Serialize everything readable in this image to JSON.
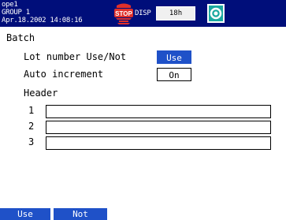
{
  "status": {
    "user": "ope1",
    "group": "GROUP 1",
    "datetime": "Apr.18.2002 14:08:16",
    "stop_icon_text": "STOP",
    "disp_label": "DISP",
    "interval": "18h",
    "media_icon": "memory-card-icon"
  },
  "page": {
    "title": "Batch",
    "lot_label": "Lot number Use/Not",
    "lot_value": "Use",
    "auto_label": "Auto increment",
    "auto_value": "On",
    "header_title": "Header",
    "header_fields": [
      {
        "num": "1",
        "value": ""
      },
      {
        "num": "2",
        "value": ""
      },
      {
        "num": "3",
        "value": ""
      }
    ]
  },
  "softkeys": [
    "Use",
    "Not"
  ],
  "colors": {
    "statusbar": "#000e7a",
    "selected": "#1f51c8",
    "stop_icon": "#e0302a"
  }
}
